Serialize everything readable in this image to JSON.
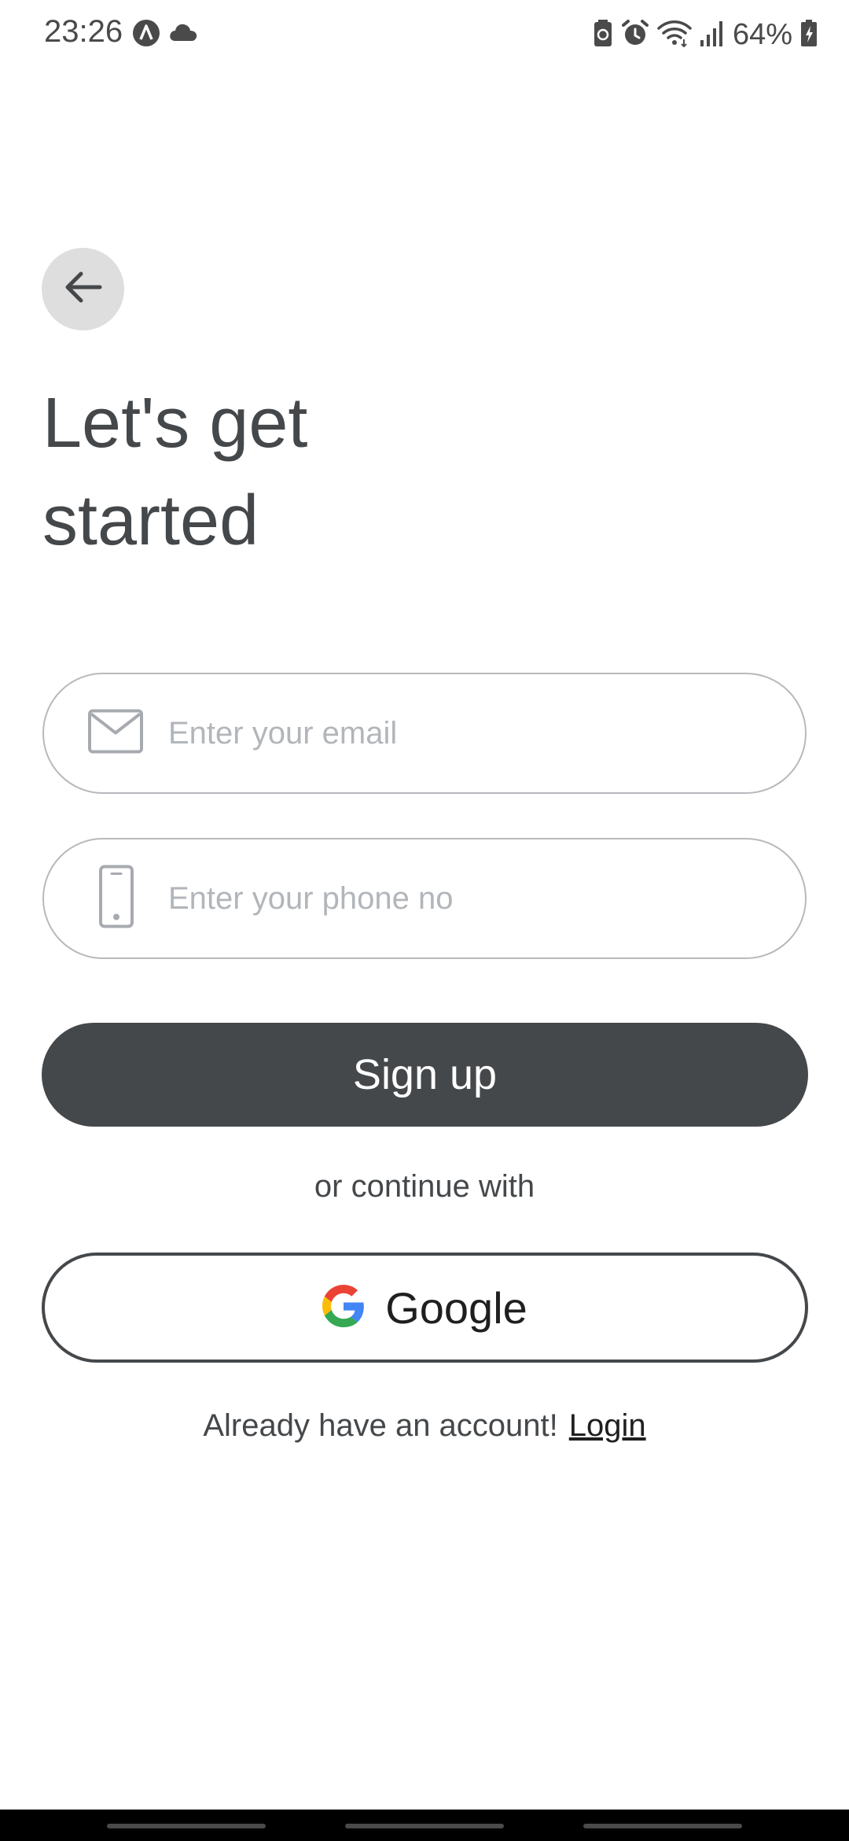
{
  "status_bar": {
    "time": "23:26",
    "battery": "64%",
    "icons": [
      "app-a-icon",
      "cloud-icon",
      "battery-saver-icon",
      "alarm-icon",
      "wifi-icon",
      "signal-icon",
      "battery-icon"
    ]
  },
  "header": {
    "back_icon": "arrow-left-icon"
  },
  "title": {
    "line1": "Let's get",
    "line2": "started"
  },
  "form": {
    "email_placeholder": "Enter your email",
    "email_value": "",
    "phone_placeholder": "Enter your phone no",
    "phone_value": "",
    "signup_label": "Sign up"
  },
  "divider": "or continue with",
  "social": {
    "google_label": "Google"
  },
  "footer": {
    "prompt": "Already have an account!",
    "login_label": "Login"
  },
  "colors": {
    "primary": "#45484b",
    "back_button_bg": "#dedede",
    "input_border": "#b7b9bc",
    "placeholder": "#b2b6bb"
  }
}
